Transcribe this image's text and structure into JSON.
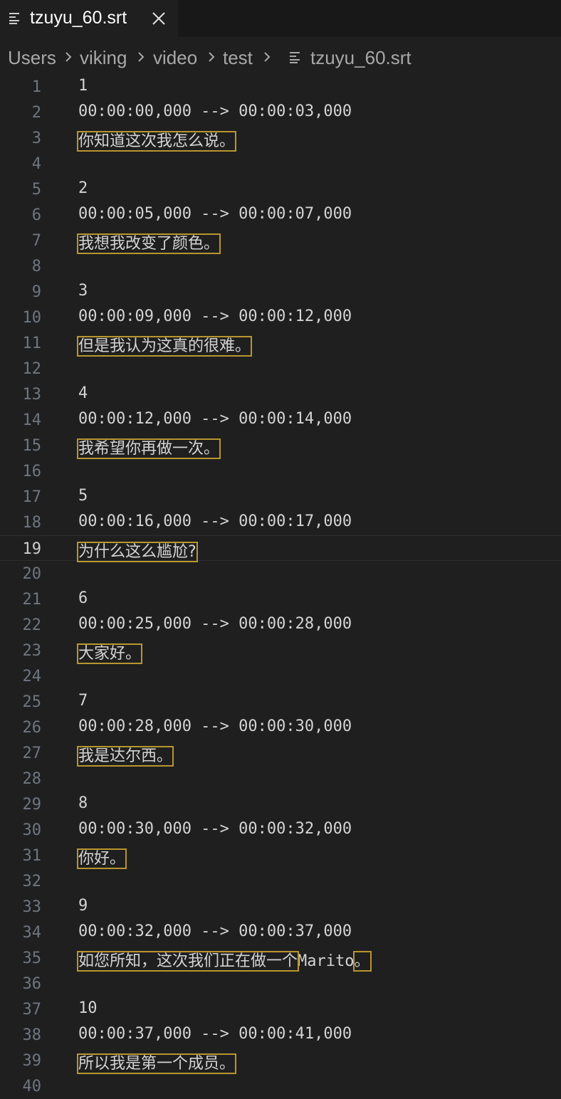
{
  "tab": {
    "title": "tzuyu_60.srt",
    "file_icon": "file-lines-icon",
    "close_icon": "close-icon"
  },
  "breadcrumb": {
    "parts": [
      "Users",
      "viking",
      "video",
      "test"
    ],
    "file": "tzuyu_60.srt",
    "separator_icon": "chevron-right-icon"
  },
  "editor": {
    "current_line": 19,
    "highlight_color": "#b8962e",
    "lines": [
      {
        "n": "1",
        "text": "1"
      },
      {
        "n": "2",
        "text": "00:00:00,000 --> 00:00:03,000"
      },
      {
        "n": "3",
        "text": "你知道这次我怎么说。",
        "highlight": true
      },
      {
        "n": "4",
        "text": ""
      },
      {
        "n": "5",
        "text": "2"
      },
      {
        "n": "6",
        "text": "00:00:05,000 --> 00:00:07,000"
      },
      {
        "n": "7",
        "text": "我想我改变了颜色。",
        "highlight": true
      },
      {
        "n": "8",
        "text": ""
      },
      {
        "n": "9",
        "text": "3"
      },
      {
        "n": "10",
        "text": "00:00:09,000 --> 00:00:12,000"
      },
      {
        "n": "11",
        "text": "但是我认为这真的很难。",
        "highlight": true
      },
      {
        "n": "12",
        "text": ""
      },
      {
        "n": "13",
        "text": "4"
      },
      {
        "n": "14",
        "text": "00:00:12,000 --> 00:00:14,000"
      },
      {
        "n": "15",
        "text": "我希望你再做一次。",
        "highlight": true
      },
      {
        "n": "16",
        "text": ""
      },
      {
        "n": "17",
        "text": "5"
      },
      {
        "n": "18",
        "text": "00:00:16,000 --> 00:00:17,000"
      },
      {
        "n": "19",
        "text": "为什么这么尴尬?",
        "highlight": true
      },
      {
        "n": "20",
        "text": ""
      },
      {
        "n": "21",
        "text": "6"
      },
      {
        "n": "22",
        "text": "00:00:25,000 --> 00:00:28,000"
      },
      {
        "n": "23",
        "text": "大家好。",
        "highlight": true
      },
      {
        "n": "24",
        "text": ""
      },
      {
        "n": "25",
        "text": "7"
      },
      {
        "n": "26",
        "text": "00:00:28,000 --> 00:00:30,000"
      },
      {
        "n": "27",
        "text": "我是达尔西。",
        "highlight": true
      },
      {
        "n": "28",
        "text": ""
      },
      {
        "n": "29",
        "text": "8"
      },
      {
        "n": "30",
        "text": "00:00:30,000 --> 00:00:32,000"
      },
      {
        "n": "31",
        "text": "你好。",
        "highlight": true
      },
      {
        "n": "32",
        "text": ""
      },
      {
        "n": "33",
        "text": "9"
      },
      {
        "n": "34",
        "text": "00:00:32,000 --> 00:00:37,000"
      },
      {
        "n": "35",
        "text": "",
        "segments": [
          {
            "text": "如您所知，这次我们正在做一个",
            "highlight": true
          },
          {
            "text": "Marito",
            "highlight": false
          },
          {
            "text": "。",
            "highlight": true
          }
        ]
      },
      {
        "n": "36",
        "text": ""
      },
      {
        "n": "37",
        "text": "10"
      },
      {
        "n": "38",
        "text": "00:00:37,000 --> 00:00:41,000"
      },
      {
        "n": "39",
        "text": "所以我是第一个成员。",
        "highlight": true
      },
      {
        "n": "40",
        "text": ""
      }
    ]
  }
}
